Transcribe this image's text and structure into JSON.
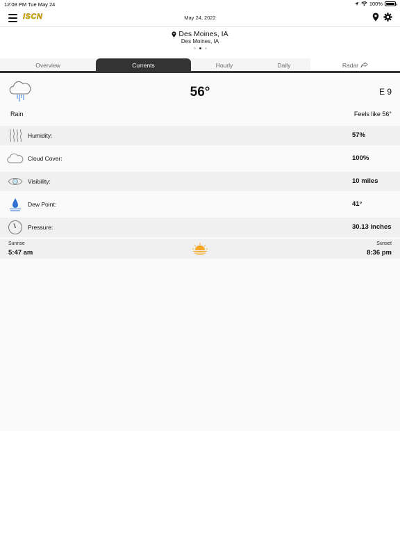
{
  "status_bar": {
    "time": "12:08 PM",
    "date": "Tue May 24",
    "battery": "100%"
  },
  "header": {
    "logo_text": "ISCN",
    "date": "May 24, 2022"
  },
  "location": {
    "name": "Des Moines, IA",
    "subtitle": "Des Moines, IA",
    "page_count": 3,
    "active_page": 2
  },
  "tabs": [
    {
      "label": "Overview",
      "active": false
    },
    {
      "label": "Currents",
      "active": true
    },
    {
      "label": "Hourly",
      "active": false
    },
    {
      "label": "Daily",
      "active": false
    },
    {
      "label": "Radar",
      "active": false
    }
  ],
  "current": {
    "icon": "rain-cloud-icon",
    "temperature": "56°",
    "wind": "E 9",
    "condition": "Rain",
    "feels_like": "Feels like 56°"
  },
  "details": [
    {
      "icon": "humidity-icon",
      "label": "Humidity:",
      "value": "57%"
    },
    {
      "icon": "cloud-icon",
      "label": "Cloud Cover:",
      "value": "100%"
    },
    {
      "icon": "eye-icon",
      "label": "Visibility:",
      "value": "10 miles"
    },
    {
      "icon": "droplet-icon",
      "label": "Dew Point:",
      "value": "41°"
    },
    {
      "icon": "gauge-icon",
      "label": "Pressure:",
      "value": "30.13 inches"
    }
  ],
  "sun": {
    "sunrise_label": "Sunrise",
    "sunrise_time": "5:47 am",
    "sunset_label": "Sunset",
    "sunset_time": "8:36 pm",
    "icon": "sunset-icon"
  },
  "colors": {
    "logo": "#f2c200",
    "active_tab": "#333333",
    "sun": "#f5a623",
    "droplet": "#2f6fd0"
  }
}
